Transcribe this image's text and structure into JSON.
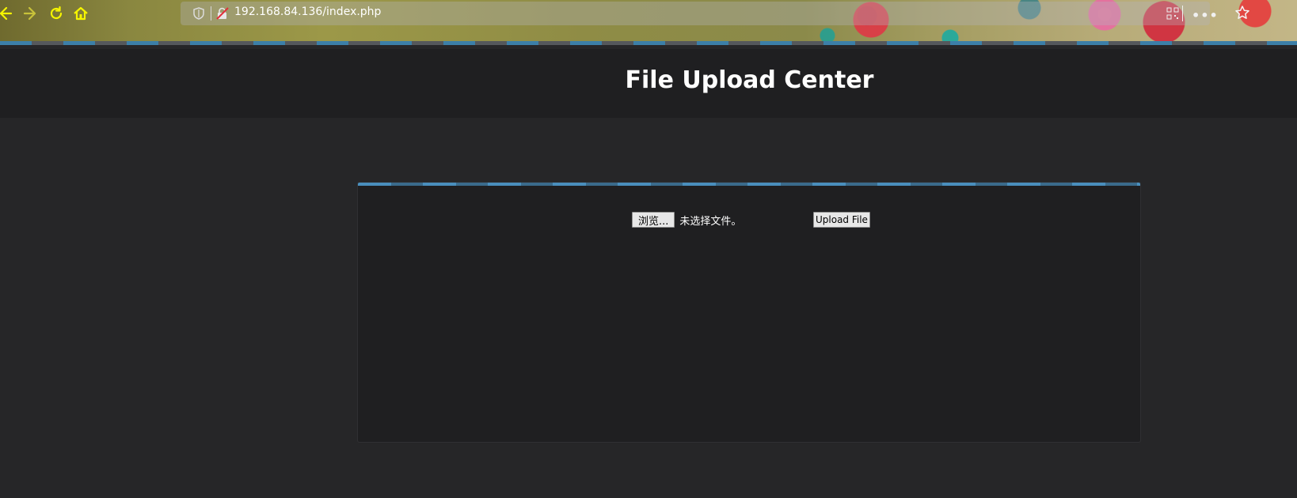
{
  "browser": {
    "url": "192.168.84.136/index.php",
    "icon_color": "#f5f500"
  },
  "page": {
    "title": "File Upload Center"
  },
  "upload_form": {
    "browse_label": "浏览...",
    "no_file_text": "未选择文件。",
    "submit_label": "Upload File"
  }
}
